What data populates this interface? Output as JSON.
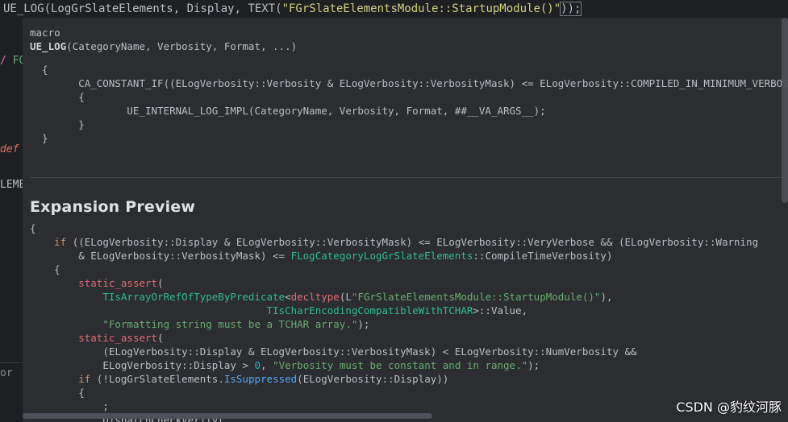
{
  "editor": {
    "line_call_prefix": "UE_LOG(LogGrSlateElements, Display, TEXT(",
    "line_call_string": "\"FGrSlateElementsModule::StartupModule()\"",
    "line_call_suffix": "));"
  },
  "gutter": {
    "frag1_a": "/",
    "frag1_b": " FG",
    "frag2": "def",
    "frag3": "LEME",
    "frag4": "or"
  },
  "popup": {
    "kind": "macro",
    "signature_name": "UE_LOG",
    "signature_params": "(CategoryName, Verbosity, Format, ...)",
    "definition": "  {\n        CA_CONSTANT_IF((ELogVerbosity::Verbosity & ELogVerbosity::VerbosityMask) <= ELogVerbosity::COMPILED_IN_MINIMUM_VERBOSITY && (E\n        {\n                UE_INTERNAL_LOG_IMPL(CategoryName, Verbosity, Format, ##__VA_ARGS__);\n        }\n  }",
    "expansion_title": "Expansion Preview"
  },
  "expansion": {
    "open_brace": "{",
    "if_kw": "if",
    "if_line": " ((ELogVerbosity::Display & ELogVerbosity::VerbosityMask) <= ELogVerbosity::VeryVerbose && (ELogVerbosity::Warning",
    "line2_a": "        & ELogVerbosity::VerbosityMask) <= ",
    "line2_cat": "FLogCategoryLogGrSlateElements",
    "line2_b": "::CompileTimeVerbosity)",
    "inner_open": "    {",
    "sa1": "static_assert",
    "sa1_paren": "(",
    "pred": "TIsArrayOrRefOfTypeByPredicate",
    "lt": "<",
    "decltype_kw": "decltype",
    "decltype_arg_a": "(L",
    "decltype_str": "\"FGrSlateElementsModule::StartupModule()\"",
    "decltype_arg_b": "),",
    "tchar_pred": "TIsCharEncodingCompatibleWithTCHAR",
    "tchar_rest": ">::Value,",
    "msg1": "\"Formatting string must be a TCHAR array.\"",
    "msg1_end": ");",
    "sa2": "static_assert",
    "sa2_paren": "(",
    "sa2_line1": "(ELogVerbosity::Display & ELogVerbosity::VerbosityMask) < ELogVerbosity::NumVerbosity &&",
    "sa2_line2a": "ELogVerbosity::Display > ",
    "sa2_zero": "0",
    "sa2_line2b": ", ",
    "msg2": "\"Verbosity must be constant and in range.\"",
    "msg2_end": ");",
    "if2_kw": "if",
    "if2_a": " (!LogGrSlateElements.",
    "if2_fn": "IsSuppressed",
    "if2_b": "(ELogVerbosity::Display))",
    "inner2_open": "        {",
    "semicolon": "            ;",
    "cut_line": "            DispatchCheckVerify("
  },
  "watermark": "CSDN @豹纹河豚"
}
